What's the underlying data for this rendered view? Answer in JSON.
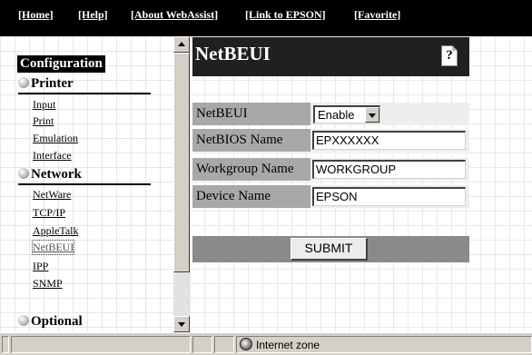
{
  "topnav": {
    "items": [
      "[Home]",
      "[Help]",
      "[About WebAssist]",
      "[Link to EPSON]",
      "[Favorite]"
    ]
  },
  "sidebar": {
    "title": "Configuration",
    "sections": [
      {
        "label": "Printer",
        "items": [
          "Input",
          "Print",
          "Emulation",
          "Interface"
        ]
      },
      {
        "label": "Network",
        "items": [
          "NetWare",
          "TCP/IP",
          "AppleTalk",
          "NetBEUI",
          "IPP",
          "SNMP"
        ]
      },
      {
        "label": "Optional"
      }
    ],
    "current_item": "NetBEUI"
  },
  "panel": {
    "title": "NetBEUI",
    "help_icon": "?",
    "fields": {
      "netbeui": {
        "label": "NetBEUI",
        "value": "Enable"
      },
      "netbios_name": {
        "label": "NetBIOS Name",
        "value": "EPXXXXXX"
      },
      "workgroup_name": {
        "label": "Workgroup Name",
        "value": "WORKGROUP"
      },
      "device_name": {
        "label": "Device Name",
        "value": "EPSON"
      }
    },
    "submit_label": "SUBMIT"
  },
  "statusbar": {
    "zone": "Internet zone"
  },
  "icons": {
    "help": "help-icon",
    "globe": "internet-zone-icon",
    "scroll_up": "scroll-up-arrow-icon",
    "scroll_down": "scroll-down-arrow-icon",
    "dropdown": "dropdown-arrow-icon",
    "section_bullet": "bullet-icon"
  }
}
